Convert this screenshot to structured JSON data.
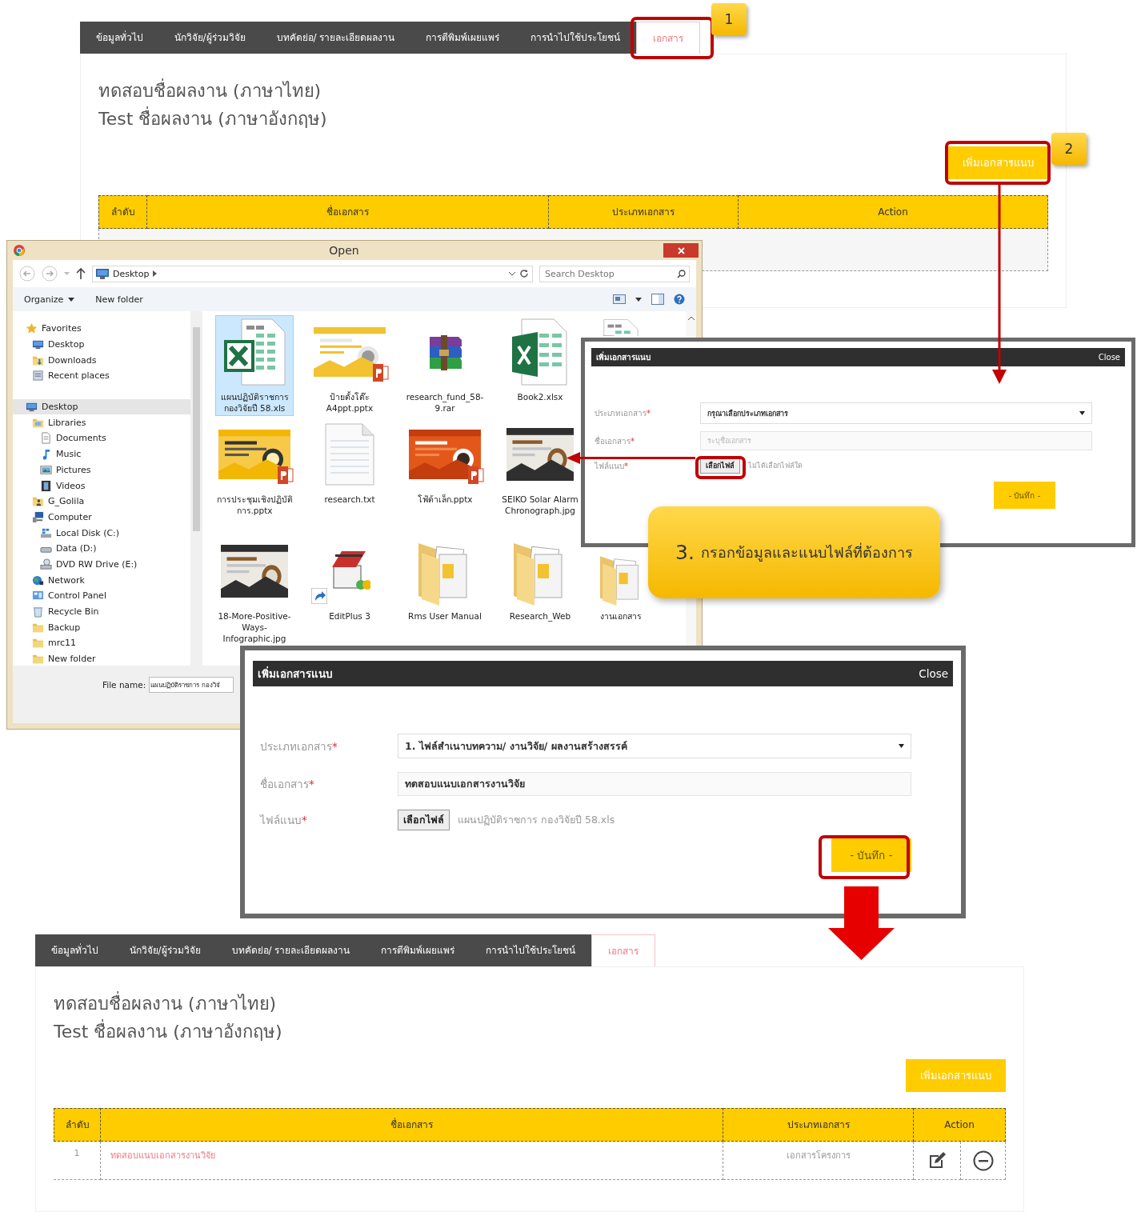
{
  "page_before": {
    "tabs": [
      {
        "label": "ข้อมูลทั่วไป",
        "selected": false
      },
      {
        "label": "นักวิจัย/ผู้ร่วมวิจัย",
        "selected": false
      },
      {
        "label": "บทคัดย่อ/ รายละเอียดผลงาน",
        "selected": false
      },
      {
        "label": "การตีพิมพ์เผยแพร่",
        "selected": false
      },
      {
        "label": "การนำไปใช้ประโยชน์",
        "selected": false
      },
      {
        "label": "เอกสาร",
        "selected": true
      }
    ],
    "titles": [
      "ทดสอบชื่อผลงาน (ภาษาไทย)",
      "Test ชื่อผลงาน (ภาษาอังกฤษ)"
    ],
    "add_button": "เพิ่มเอกสารแนบ",
    "table": {
      "columns": [
        "ลำดับ",
        "ชื่อเอกสาร",
        "ประเภทเอกสาร",
        "Action"
      ]
    }
  },
  "open_dialog": {
    "title": "Open",
    "address": "Desktop",
    "search": {
      "placeholder": "Search Desktop"
    },
    "toolbar": [
      {
        "label": "Organize",
        "menu": true
      },
      {
        "label": "New folder",
        "menu": false
      }
    ],
    "tree": [
      {
        "label": "Favorites",
        "kind": "favorites",
        "selected": false,
        "children": [
          {
            "label": "Desktop",
            "kind": "desktop",
            "selected": false
          },
          {
            "label": "Downloads",
            "kind": "downloads",
            "selected": false
          },
          {
            "label": "Recent places",
            "kind": "recent",
            "selected": false
          }
        ]
      },
      {
        "label": "Desktop",
        "kind": "desktop",
        "selected": true,
        "children": [
          {
            "label": "Libraries",
            "kind": "library",
            "selected": false,
            "children": [
              {
                "label": "Documents",
                "kind": "document",
                "selected": false
              },
              {
                "label": "Music",
                "kind": "music",
                "selected": false
              },
              {
                "label": "Pictures",
                "kind": "pictures",
                "selected": false
              },
              {
                "label": "Videos",
                "kind": "videos",
                "selected": false
              }
            ]
          },
          {
            "label": "G_Golila",
            "kind": "user",
            "selected": false
          },
          {
            "label": "Computer",
            "kind": "computer",
            "selected": false,
            "children": [
              {
                "label": "Local Disk (C:)",
                "kind": "disk",
                "selected": false
              },
              {
                "label": "Data (D:)",
                "kind": "drive",
                "selected": false
              },
              {
                "label": "DVD RW Drive (E:)",
                "kind": "dvd",
                "selected": false
              }
            ]
          },
          {
            "label": "Network",
            "kind": "network",
            "selected": false
          },
          {
            "label": "Control Panel",
            "kind": "control",
            "selected": false
          },
          {
            "label": "Recycle Bin",
            "kind": "recycle",
            "selected": false
          },
          {
            "label": "Backup",
            "kind": "folder",
            "selected": false
          },
          {
            "label": "mrc11",
            "kind": "folder",
            "selected": false
          },
          {
            "label": "New folder",
            "kind": "folder",
            "selected": false
          }
        ]
      }
    ],
    "file_rows": [
      [
        {
          "name": "แผนปฏิบัติราชการ กองวิจัยปี 58.xls",
          "kind": "spreadsheet",
          "selected": true
        },
        {
          "name": "ป้ายตั้งโต๊ะ A4ppt.pptx",
          "kind": "slides",
          "selected": false
        },
        {
          "name": "research_fund_58-9.rar",
          "kind": "archive",
          "selected": false
        },
        {
          "name": "Book2.xlsx",
          "kind": "excel",
          "selected": false
        },
        {
          "kind": "spreadsheet",
          "selected": false
        }
      ],
      [
        {
          "name": "การประชุมเชิงปฏิบัติการ.pptx",
          "kind": "slides",
          "selected": false
        },
        {
          "name": "research.txt",
          "kind": "text",
          "selected": false
        },
        {
          "name": "โฟ้ต้าเล็ก.pptx",
          "kind": "slides",
          "selected": false
        },
        {
          "name": "SEIKO Solar Alarm Chronograph.jpg",
          "selected": false
        }
      ],
      [
        {
          "name": "18-More-Positive-Ways-Infographic.jpg",
          "selected": false
        },
        {
          "name": "EditPlus 3",
          "kind": "app",
          "selected": false
        },
        {
          "name": "Rms User Manual",
          "kind": "folder",
          "selected": false
        },
        {
          "name": "Research_Web",
          "kind": "folder",
          "selected": false
        },
        {
          "name": "งานเอกสาร",
          "kind": "folder",
          "selected": false
        }
      ]
    ],
    "file_name": {
      "label": "File name:",
      "value": "แผนปฏิบัติราชการ กองวิจั"
    }
  },
  "modal_empty": {
    "title": "เพิ่มเอกสารแนบ",
    "close": "Close",
    "fields": [
      {
        "kind": "select",
        "label": "ประเภทเอกสาร",
        "mark": "*",
        "value": "กรุณาเลือกประเภทเอกสาร"
      },
      {
        "kind": "input",
        "label": "ชื่อเอกสาร",
        "mark": "*",
        "placeholder": "ระบุชื่อเอกสาร"
      },
      {
        "kind": "file",
        "label": "ไฟล์แนบ",
        "mark": "*",
        "button": "เลือกไฟล์",
        "status": "ไม่ได้เลือกไฟล์ใด"
      }
    ],
    "save": "- บันทึก -"
  },
  "modal_filled": {
    "title": "เพิ่มเอกสารแนบ",
    "close": "Close",
    "fields": [
      {
        "kind": "select",
        "label": "ประเภทเอกสาร",
        "mark": "*",
        "value": "1. ไฟล์สำเนาบทความ/ งานวิจัย/ ผลงานสร้างสรรค์"
      },
      {
        "kind": "input",
        "label": "ชื่อเอกสาร",
        "mark": "*",
        "value": "ทดสอบแนบเอกสารงานวิจัย"
      },
      {
        "kind": "file",
        "label": "ไฟล์แนบ",
        "mark": "*",
        "button": "เลือกไฟล์",
        "status": "แผนปฏิบัติราชการ กองวิจัยปี 58.xls"
      }
    ],
    "save": "- บันทึก -"
  },
  "page_after": {
    "tabs": [
      {
        "label": "ข้อมูลทั่วไป",
        "selected": false
      },
      {
        "label": "นักวิจัย/ผู้ร่วมวิจัย",
        "selected": false
      },
      {
        "label": "บทคัดย่อ/ รายละเอียดผลงาน",
        "selected": false
      },
      {
        "label": "การตีพิมพ์เผยแพร่",
        "selected": false
      },
      {
        "label": "การนำไปใช้ประโยชน์",
        "selected": false
      },
      {
        "label": "เอกสาร",
        "selected": true
      }
    ],
    "titles": [
      "ทดสอบชื่อผลงาน (ภาษาไทย)",
      "Test ชื่อผลงาน (ภาษาอังกฤษ)"
    ],
    "add_button": "เพิ่มเอกสารแนบ",
    "table": {
      "columns": [
        "ลำดับ",
        "ชื่อเอกสาร",
        "ประเภทเอกสาร",
        "Action"
      ],
      "rows": [
        {
          "number": "1",
          "name": "ทดสอบแนบเอกสารงานวิจัย",
          "type": "เอกสารโครงการ"
        }
      ]
    }
  },
  "annotations": {
    "badges": [
      "1",
      "2"
    ],
    "callout": {
      "number": "3.",
      "text": "กรอกข้อมูลและแนบไฟล์ที่ต้องการ"
    }
  }
}
